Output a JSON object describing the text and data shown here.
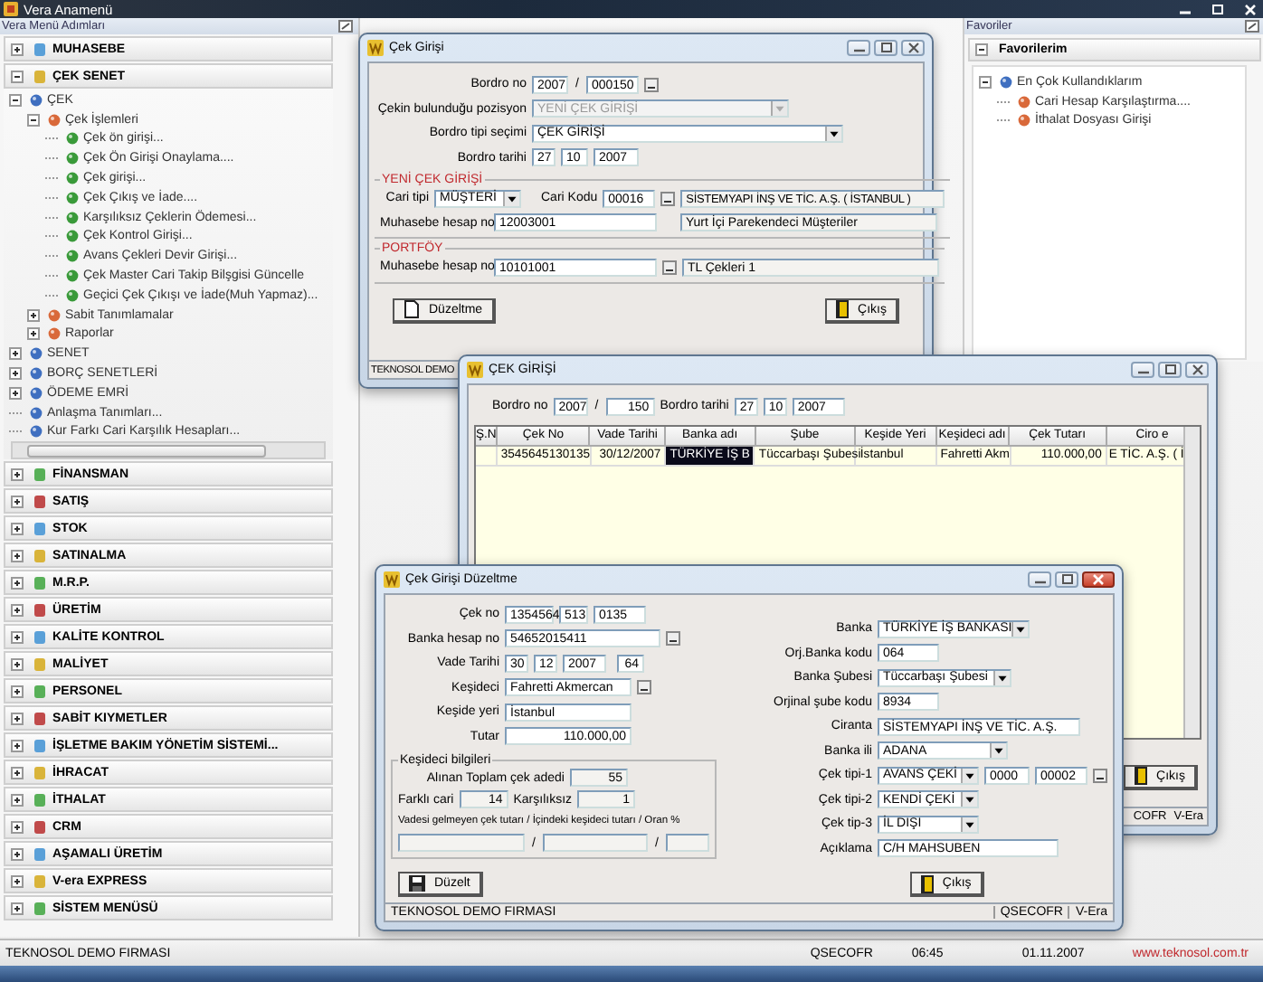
{
  "app": {
    "title": "Vera Anamenü"
  },
  "menu_panel": {
    "title": "Vera Menü Adımları",
    "modules": [
      {
        "label": "MUHASEBE",
        "expanded": false
      },
      {
        "label": "ÇEK SENET",
        "expanded": true,
        "children": [
          {
            "label": "ÇEK",
            "expanded": true,
            "children": [
              {
                "label": "Çek İşlemleri",
                "expanded": true,
                "children": [
                  {
                    "label": "Çek ön girişi..."
                  },
                  {
                    "label": "Çek Ön Girişi Onaylama...."
                  },
                  {
                    "label": "Çek girişi..."
                  },
                  {
                    "label": "Çek Çıkış ve İade...."
                  },
                  {
                    "label": "Karşılıksız Çeklerin Ödemesi..."
                  },
                  {
                    "label": "Çek Kontrol Girişi..."
                  },
                  {
                    "label": "Avans Çekleri Devir Girişi..."
                  },
                  {
                    "label": "Çek Master Cari Takip Bilşgisi Güncelle"
                  },
                  {
                    "label": "Geçici Çek Çıkışı ve İade(Muh Yapmaz)..."
                  }
                ]
              },
              {
                "label": "Sabit Tanımlamalar",
                "expanded": false
              },
              {
                "label": "Raporlar",
                "expanded": false
              }
            ]
          },
          {
            "label": "SENET",
            "expanded": false
          },
          {
            "label": "BORÇ SENETLERİ",
            "expanded": false
          },
          {
            "label": "ÖDEME EMRİ",
            "expanded": false
          },
          {
            "label": "Anlaşma Tanımları..."
          },
          {
            "label": "Kur Farkı Cari Karşılık Hesapları..."
          }
        ]
      },
      {
        "label": "FİNANSMAN",
        "expanded": false
      },
      {
        "label": "SATIŞ",
        "expanded": false
      },
      {
        "label": "STOK",
        "expanded": false
      },
      {
        "label": "SATINALMA",
        "expanded": false
      },
      {
        "label": "M.R.P.",
        "expanded": false
      },
      {
        "label": "ÜRETİM",
        "expanded": false
      },
      {
        "label": "KALİTE KONTROL",
        "expanded": false
      },
      {
        "label": "MALİYET",
        "expanded": false
      },
      {
        "label": "PERSONEL",
        "expanded": false
      },
      {
        "label": "SABİT KIYMETLER",
        "expanded": false
      },
      {
        "label": "İŞLETME BAKIM YÖNETİM SİSTEMİ...",
        "expanded": false
      },
      {
        "label": "İHRACAT",
        "expanded": false
      },
      {
        "label": "İTHALAT",
        "expanded": false
      },
      {
        "label": "CRM",
        "expanded": false
      },
      {
        "label": "AŞAMALI ÜRETİM",
        "expanded": false
      },
      {
        "label": "V-era EXPRESS",
        "expanded": false
      },
      {
        "label": "SİSTEM MENÜSÜ",
        "expanded": false
      }
    ]
  },
  "favorites_panel": {
    "title": "Favoriler",
    "group": {
      "label": "Favorilerim",
      "expanded": true
    },
    "tree": [
      {
        "label": "En Çok Kullandıklarım",
        "expanded": true,
        "children": [
          {
            "label": "Cari Hesap Karşılaştırma...."
          },
          {
            "label": "İthalat Dosyası Girişi"
          }
        ]
      }
    ]
  },
  "entry_window": {
    "title": "Çek Girişi",
    "bordro_no": {
      "label": "Bordro no",
      "year": "2007",
      "separator": "/",
      "number": "000150"
    },
    "position": {
      "label": "Çekin bulunduğu pozisyon",
      "value": "YENİ ÇEK GİRİŞİ",
      "disabled": true
    },
    "bordro_type": {
      "label": "Bordro tipi seçimi",
      "value": "ÇEK GİRİŞİ",
      "disabled": false
    },
    "bordro_date": {
      "label": "Bordro tarihi",
      "day": "27",
      "month": "10",
      "year": "2007"
    },
    "new_check_group": {
      "title": "YENİ ÇEK GİRİŞİ",
      "cari_type": {
        "label": "Cari tipi",
        "value": "MÜŞTERİ"
      },
      "cari_code": {
        "label": "Cari Kodu",
        "value": "00016",
        "name": "SİSTEMYAPI İNŞ VE TİC. A.Ş. ( İSTANBUL )"
      },
      "account": {
        "label": "Muhasebe hesap no",
        "value": "12003001",
        "description": "Yurt İçi Parekendeci Müşteriler"
      }
    },
    "portfolio_group": {
      "title": "PORTFÖY",
      "account": {
        "label": "Muhasebe hesap no",
        "value": "10101001",
        "description": "TL Çekleri 1"
      }
    },
    "buttons": [
      {
        "label": "Düzeltme",
        "kind": "edit"
      },
      {
        "label": "Çıkış",
        "kind": "exit"
      }
    ],
    "status": "TEKNOSOL DEMO"
  },
  "list_window": {
    "title": "ÇEK GİRİŞİ",
    "bordro_no": {
      "label": "Bordro no",
      "year": "2007",
      "separator": "/",
      "number": "150"
    },
    "bordro_date": {
      "label": "Bordro tarihi",
      "day": "27",
      "month": "10",
      "year": "2007"
    },
    "table": {
      "columns": [
        "Ş.N",
        "Çek No",
        "Vade Tarihi",
        "Banka adı",
        "Şube",
        "Keşide Yeri",
        "Keşideci adı",
        "Çek Tutarı",
        "Ciro e"
      ],
      "rows": [
        {
          "cells": [
            {
              "selected": false
            },
            {
              "text": "3545645130135",
              "selected": false
            },
            {
              "text": "30/12/2007",
              "selected": false
            },
            {
              "text": "TÜRKİYE İŞ B",
              "selected": true
            },
            {
              "text": "Tüccarbaşı Şubesi",
              "selected": false
            },
            {
              "text": "İstanbul",
              "selected": false
            },
            {
              "text": "Fahretti Akm",
              "selected": false
            },
            {
              "text": "110.000,00",
              "selected": false
            },
            {
              "text": "E TİC. A.Ş. ( İ",
              "selected": false
            }
          ]
        }
      ]
    },
    "buttons": [
      {
        "label": "Çıkış",
        "kind": "exit"
      }
    ],
    "status": [
      "COFR",
      "V-Era"
    ]
  },
  "edit_window": {
    "title": "Çek Girişi Düzeltme",
    "cek_no": {
      "label": "Çek no",
      "parts": [
        "1354564",
        "513",
        "0135"
      ]
    },
    "bank_account": {
      "label": "Banka hesap no",
      "value": "54652015411"
    },
    "due_date": {
      "label": "Vade Tarihi",
      "day": "30",
      "month": "12",
      "year": "2007",
      "days": "64"
    },
    "drawer": {
      "label": "Keşideci",
      "value": "Fahretti Akmercan"
    },
    "drawn_place": {
      "label": "Keşide yeri",
      "value": "İstanbul"
    },
    "amount": {
      "label": "Tutar",
      "value": "110.000,00"
    },
    "drawer_info": {
      "title": "Keşideci bilgileri",
      "total_label": "Alınan Toplam çek adedi",
      "total": "55",
      "diff_label": "Farklı cari",
      "diff": "14",
      "bounced_label": "Karşılıksız",
      "bounced": "1",
      "ratio_label": "Vadesi gelmeyen çek tutarı / İçindeki keşideci tutarı / Oran %",
      "separators": [
        "/",
        "/"
      ]
    },
    "bank": {
      "label": "Banka",
      "value": "TÜRKİYE İŞ BANKASI"
    },
    "bank_code": {
      "label": "Orj.Banka kodu",
      "value": "064"
    },
    "branch": {
      "label": "Banka Şubesi",
      "value": "Tüccarbaşı Şubesi"
    },
    "branch_code": {
      "label": "Orjinal şube kodu",
      "value": "8934"
    },
    "endorser": {
      "label": "Ciranta",
      "value": "SİSTEMYAPI İNŞ VE TİC. A.Ş."
    },
    "bank_city": {
      "label": "Banka ili",
      "value": "ADANA"
    },
    "type1": {
      "label": "Çek tipi-1",
      "value": "AVANS ÇEKİ",
      "code1": "0000",
      "code2": "00002"
    },
    "type2": {
      "label": "Çek tipi-2",
      "value": "KENDİ ÇEKİ"
    },
    "type3": {
      "label": "Çek tip-3",
      "value": "İL DIŞI"
    },
    "note": {
      "label": "Açıklama",
      "value": "C/H MAHSUBEN"
    },
    "buttons": [
      {
        "label": "Düzelt",
        "kind": "save"
      },
      {
        "label": "Çıkış",
        "kind": "exit"
      }
    ],
    "status": {
      "company": "TEKNOSOL DEMO FIRMASI",
      "user": "QSECOFR",
      "app": "V-Era"
    }
  },
  "status_bar": {
    "company": "TEKNOSOL DEMO FIRMASI",
    "user": "QSECOFR",
    "time": "06:45",
    "date": "01.11.2007",
    "website": "www.teknosol.com.tr"
  }
}
